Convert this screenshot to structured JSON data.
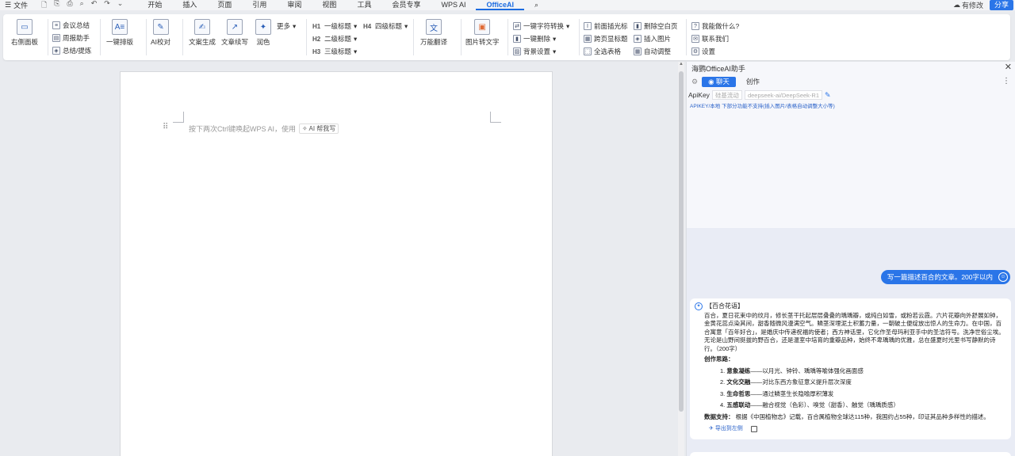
{
  "menubar": {
    "file_label": "文件",
    "tabs": [
      "开始",
      "插入",
      "页面",
      "引用",
      "审阅",
      "视图",
      "工具",
      "会员专享",
      "WPS AI",
      "OfficeAI"
    ],
    "active_tab": "OfficeAI",
    "modified_label": "有修改",
    "share_label": "分享"
  },
  "ribbon": {
    "right_panel": "右侧面板",
    "meeting_summary": "会议总结",
    "weekly_report": "周报助手",
    "summary_extract": "总结/提炼",
    "one_click_layout": "一键排版",
    "ai_proofread": "AI校对",
    "copy_generate": "文案生成",
    "copy_continue": "文章续写",
    "polish": "润色",
    "more": "更多",
    "h1": "一级标题",
    "h2": "二级标题",
    "h3": "三级标题",
    "h4": "四级标题",
    "translate": "万能翻译",
    "img_to_text": "图片转文字",
    "char_convert": "一键字符转换",
    "one_click_delete": "一键删除",
    "bg_settings": "背景设置",
    "front_highlight": "前面插光标",
    "cross_page_header": "跨页显标题",
    "select_table": "全选表格",
    "delete_blank_page": "删除空白页",
    "insert_image": "插入图片",
    "auto_adjust": "自动调整",
    "what_can_i_do": "我能做什么?",
    "contact_us": "联系我们",
    "settings": "设置"
  },
  "document": {
    "hint_text": "按下两次Ctrl键唤起WPS AI，使用",
    "ai_help_label": "AI 帮我写"
  },
  "panel": {
    "title": "海鹦OfficeAI助手",
    "tab_chat": "聊天",
    "tab_create": "创作",
    "apikey_label": "ApiKey",
    "provider": "硅基流动",
    "model": "deepseek-ai/DeepSeek-R1",
    "apikey_note": "APIKEY/本地 下部分功能不支持(插入图片/表格自动调整大小等)",
    "user_message": "写一篇描述百合的文章。200字以内",
    "ai_heading": "【百合花语】",
    "ai_body": "百合，夏日花束中的纹月，修长茎干托起层层叠叠的瑀瑀瓣，或纯白如雪，或粉若云霞。六片花瓣向外舒展如钟，金黄花蕊点染其间，甜香随微风漫满空气。鳞茎深埋泥土积蓄力量，一朝破土便绽放出惊人的生命力。在中国，百合寓意「百年好合」，是婚庆中传递祝福的使者；西方神话里，它化作圣母玛利亚手中的圣洁符号。洗净世俗尘埃。无论是山野间挺拔的野百合，还是温室中培育的重瓣品种，始终不卑瑀瑀的优雅，总在盛夏时光里书写静默的诗行。（200字）",
    "ideas_title": "创作思路：",
    "ideas": [
      {
        "num": "1.",
        "bold": "意象凝练",
        "rest": "——以月光、钟铃、瑀瑀等喻体强化画面感"
      },
      {
        "num": "2.",
        "bold": "文化交融",
        "rest": "——对比东西方象征意义提升层次深度"
      },
      {
        "num": "3.",
        "bold": "生命哲思",
        "rest": "——通过鳞茎生长隐喻厚积薄发"
      },
      {
        "num": "4.",
        "bold": "五感联动",
        "rest": "——融合视觉（色彩）、嗅觉（甜香）、触觉（瑀瑀质感）"
      }
    ],
    "data_label": "数据支持：",
    "data_text": "根据《中国植物志》记载，百合属植物全球达115种，我国约占55种，印证其品种多样性的描述。",
    "export_label": "导出到左侧"
  }
}
